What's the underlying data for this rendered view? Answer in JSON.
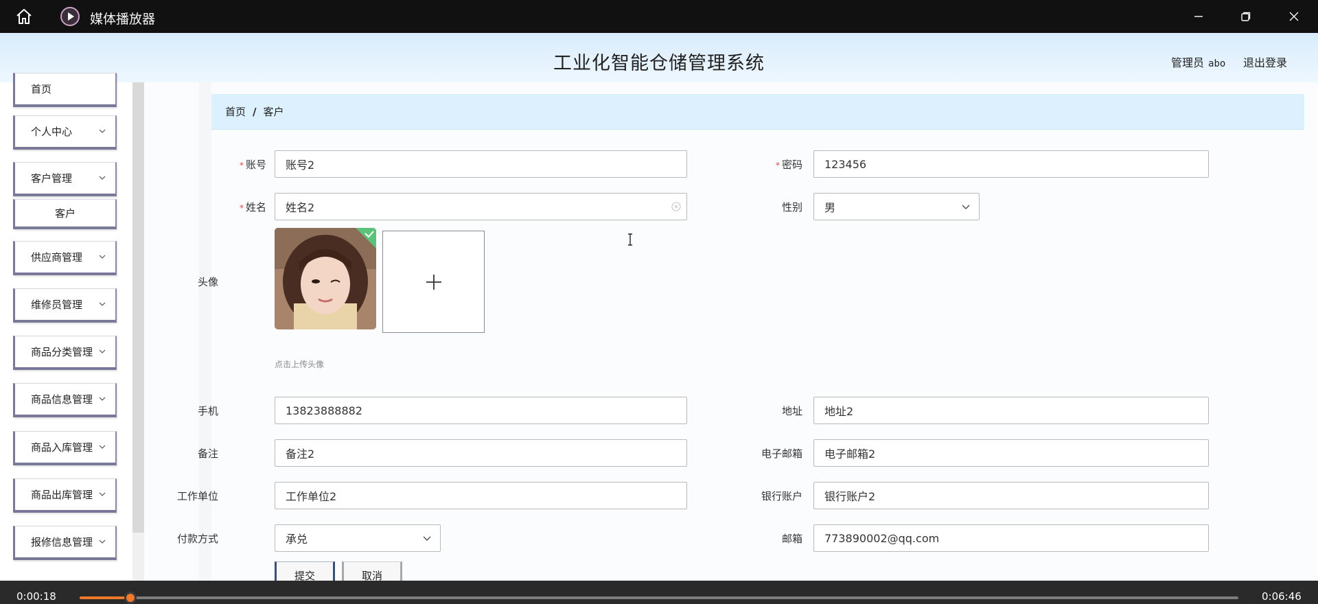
{
  "player": {
    "title": "媒体播放器",
    "current_time": "0:00:18",
    "total_time": "0:06:46",
    "progress_fraction": 0.044,
    "accent_color": "#f07a2a"
  },
  "app": {
    "title": "工业化智能仓储管理系统",
    "user_role": "管理员",
    "user_name": "abo",
    "logout_label": "退出登录"
  },
  "sidebar": {
    "items": [
      {
        "label": "首页",
        "has_chevron": false
      },
      {
        "label": "个人中心",
        "has_chevron": true
      },
      {
        "label": "客户管理",
        "has_chevron": true
      },
      {
        "label": "客户",
        "has_chevron": false,
        "sub": true
      },
      {
        "label": "供应商管理",
        "has_chevron": true
      },
      {
        "label": "维修员管理",
        "has_chevron": true
      },
      {
        "label": "商品分类管理",
        "has_chevron": true
      },
      {
        "label": "商品信息管理",
        "has_chevron": true
      },
      {
        "label": "商品入库管理",
        "has_chevron": true
      },
      {
        "label": "商品出库管理",
        "has_chevron": true
      },
      {
        "label": "报修信息管理",
        "has_chevron": true
      }
    ]
  },
  "breadcrumb": {
    "home": "首页",
    "separator": "/",
    "current": "客户"
  },
  "form": {
    "account": {
      "label": "账号",
      "value": "账号2",
      "required": true
    },
    "password": {
      "label": "密码",
      "value": "123456",
      "required": true
    },
    "name": {
      "label": "姓名",
      "value": "姓名2",
      "required": true
    },
    "gender": {
      "label": "性别",
      "value": "男"
    },
    "avatar": {
      "label": "头像",
      "upload_tip": "点击上传头像",
      "add_icon": "plus-icon"
    },
    "phone": {
      "label": "手机",
      "value": "13823888882"
    },
    "address": {
      "label": "地址",
      "value": "地址2"
    },
    "remark": {
      "label": "备注",
      "value": "备注2"
    },
    "email": {
      "label": "电子邮箱",
      "value": "电子邮箱2"
    },
    "employer": {
      "label": "工作单位",
      "value": "工作单位2"
    },
    "bank_account": {
      "label": "银行账户",
      "value": "银行账户2"
    },
    "payment": {
      "label": "付款方式",
      "value": "承兑"
    },
    "mailbox": {
      "label": "邮箱",
      "value": "773890002@qq.com"
    },
    "submit_label": "提交",
    "cancel_label": "取消"
  }
}
